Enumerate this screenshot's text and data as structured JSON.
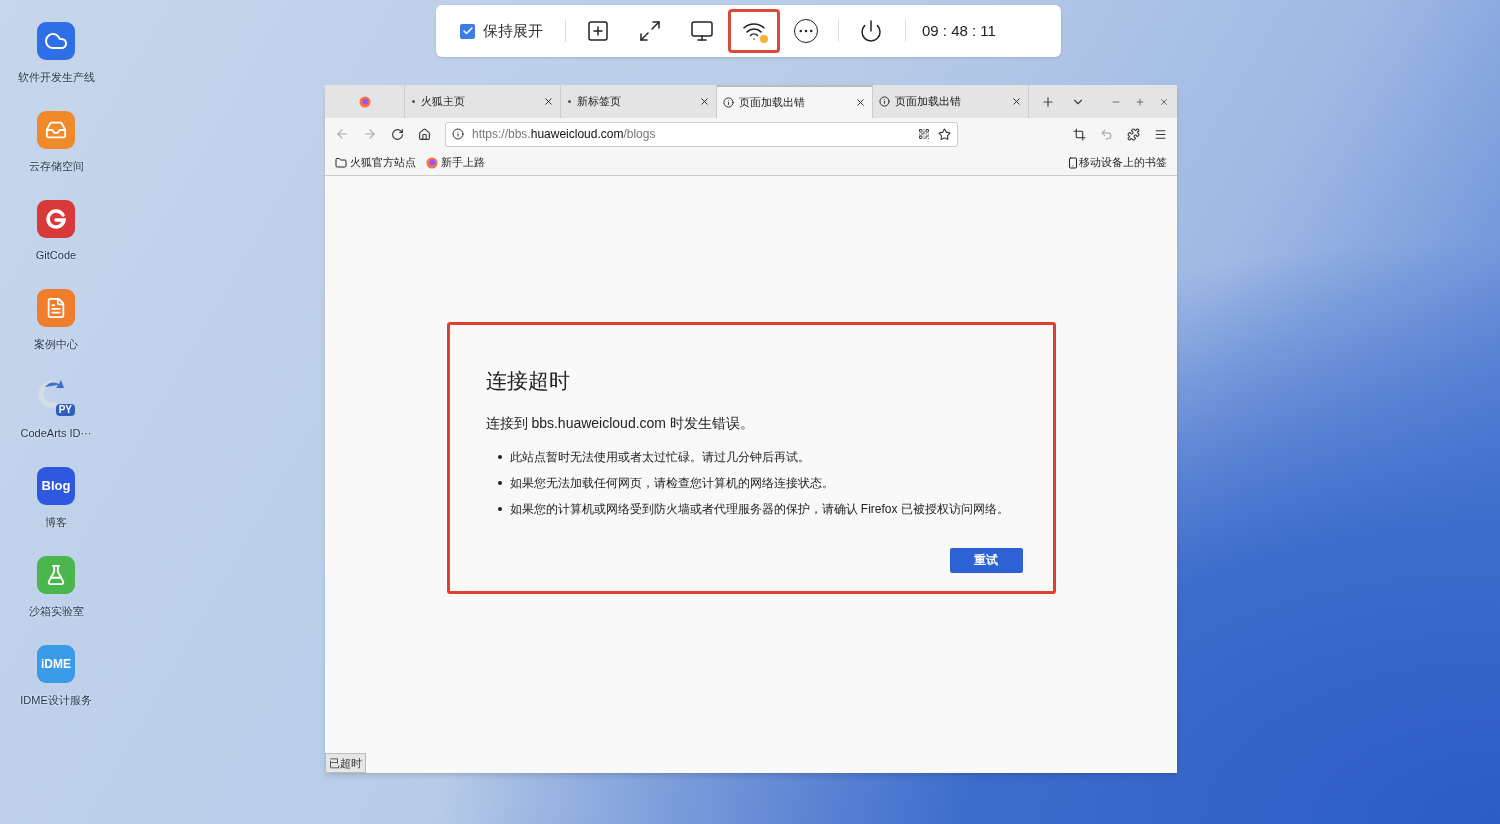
{
  "desktop_icons": [
    {
      "kind": "cloud",
      "label": "软件开发生产线"
    },
    {
      "kind": "storage",
      "label": "云存储空间"
    },
    {
      "kind": "gitcode",
      "label": "GitCode"
    },
    {
      "kind": "cases",
      "label": "案例中心"
    },
    {
      "kind": "py",
      "label": "CodeArts ID···",
      "logo_text": "PY"
    },
    {
      "kind": "blog",
      "label": "博客",
      "logo_text": "Blog"
    },
    {
      "kind": "lab",
      "label": "沙箱实验室"
    },
    {
      "kind": "idme",
      "label": "IDME设计服务",
      "logo_text": "iDME"
    }
  ],
  "toolbar": {
    "keep_open": {
      "label": "保持展开",
      "checked": true
    },
    "buttons": [
      {
        "kind": "add",
        "highlighted": false
      },
      {
        "kind": "fullscreen",
        "highlighted": false
      },
      {
        "kind": "screen",
        "highlighted": false
      },
      {
        "kind": "wifi",
        "highlighted": true
      },
      {
        "kind": "more",
        "highlighted": false
      },
      {
        "kind": "power",
        "highlighted": false
      }
    ],
    "time": "09 : 48 : 11"
  },
  "browser": {
    "tabs": [
      {
        "kind": "pinned",
        "selected": false
      },
      {
        "kind": "page",
        "title": "火狐主页",
        "selected": false
      },
      {
        "kind": "page",
        "title": "新标签页",
        "selected": false
      },
      {
        "kind": "error",
        "title": "页面加载出错",
        "selected": true
      },
      {
        "kind": "error",
        "title": "页面加载出错",
        "selected": false
      }
    ],
    "url": {
      "prefix": "https://bbs.",
      "domain": "huaweicloud.com",
      "path": "/blogs"
    },
    "bookmarks": [
      {
        "kind": "folder",
        "label": "火狐官方站点"
      },
      {
        "kind": "firefox",
        "label": "新手上路"
      }
    ],
    "mobile_bookmarks": "移动设备上的书签",
    "error": {
      "highlighted": true,
      "title": "连接超时",
      "message": "连接到 bbs.huaweicloud.com 时发生错误。",
      "bullets": [
        "此站点暂时无法使用或者太过忙碌。请过几分钟后再试。",
        "如果您无法加载任何网页，请检查您计算机的网络连接状态。",
        "如果您的计算机或网络受到防火墙或者代理服务器的保护，请确认 Firefox 已被授权访问网络。"
      ],
      "retry": "重试"
    },
    "status": "已超时"
  }
}
